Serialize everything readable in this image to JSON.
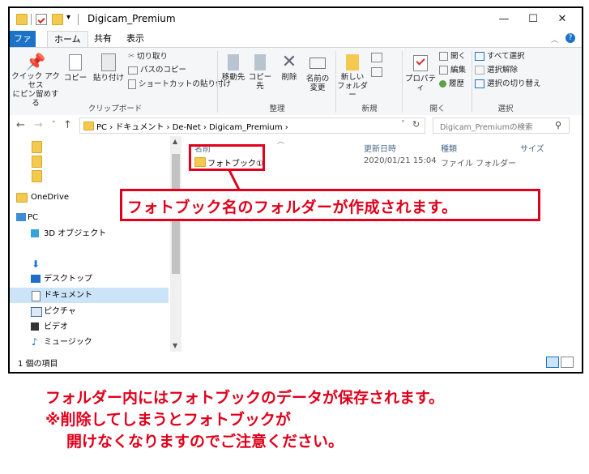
{
  "window": {
    "title": "Digicam_Premium",
    "controls": {
      "minimize": "—",
      "maximize": "☐",
      "close": "✕"
    }
  },
  "ribbon": {
    "tabs": [
      "ファイル",
      "ホーム",
      "共有",
      "表示"
    ],
    "help_glyph": "?",
    "clipboard": {
      "pin_label_1": "クイック アクセス",
      "pin_label_2": "にピン留めする",
      "copy": "コピー",
      "paste": "貼り付け",
      "cut": "切り取り",
      "copy_path": "パスのコピー",
      "paste_shortcut": "ショートカットの貼り付け",
      "group": "クリップボード"
    },
    "organize": {
      "move_to": "移動先",
      "copy_to": "コピー先",
      "delete": "削除",
      "rename_1": "名前の",
      "rename_2": "変更",
      "group": "整理"
    },
    "new": {
      "new_folder_1": "新しい",
      "new_folder_2": "フォルダー",
      "group": "新規"
    },
    "open": {
      "properties": "プロパティ",
      "open": "開く",
      "edit": "編集",
      "history": "履歴",
      "group": "開く"
    },
    "select": {
      "select_all": "すべて選択",
      "select_none": "選択解除",
      "invert": "選択の切り替え",
      "group": "選択"
    }
  },
  "address": {
    "path": "PC  ›  ドキュメント  ›  De-Net  ›  Digicam_Premium  ›",
    "search_placeholder": "Digicam_Premiumの検索"
  },
  "nav_pane": {
    "items": [
      "OneDrive",
      "PC",
      "3D オブジェクト",
      "デスクトップ",
      "ドキュメント",
      "ピクチャ",
      "ビデオ",
      "ミュージック"
    ]
  },
  "file_list": {
    "columns": [
      "名前",
      "更新日時",
      "種類",
      "サイズ"
    ],
    "rows": [
      {
        "name": "フォトブック①",
        "modified": "2020/01/21 15:04",
        "type": "ファイル フォルダー",
        "size": ""
      }
    ]
  },
  "status_bar": {
    "count": "1 個の項目"
  },
  "annotation": {
    "callout": "フォトブック名のフォルダーが作成されます。",
    "note_line1": "フォルダー内にはフォトブックのデータが保存されます。",
    "note_line2": "※削除してしまうとフォトブックが",
    "note_line3": "開けなくなりますのでご注意ください。",
    "color": "#e0001b"
  },
  "colors": {
    "accent": "#1a73c8",
    "folder": "#f3c94f",
    "selected_nav": "#cce4f7"
  }
}
